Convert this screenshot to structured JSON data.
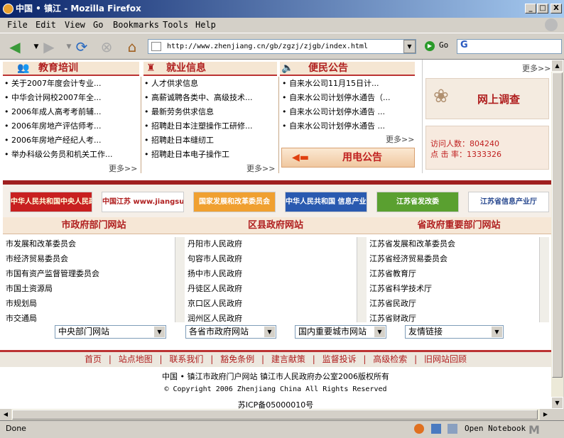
{
  "window": {
    "title": "中国 • 镇江 - Mozilla Firefox",
    "min": "_",
    "max": "□",
    "close": "X"
  },
  "menu": [
    "File",
    "Edit",
    "View",
    "Go",
    "Bookmarks",
    "Tools",
    "Help"
  ],
  "nav": {
    "url": "http://www.zhenjiang.cn/gb/zgzj/zjgb/index.html",
    "go_label": "Go",
    "search_placeholder": "G"
  },
  "sections": {
    "education": {
      "title": "教育培训",
      "items": [
        "关于2007年度会计专业...",
        "中华会计网校2007年全...",
        "2006年成人高考考前辅...",
        "2006年房地产评估师考...",
        "2006年房地产经纪人考...",
        "举办科级公务员和机关工作..."
      ],
      "more": "更多>>"
    },
    "jobs": {
      "title": "就业信息",
      "items": [
        "人才供求信息",
        "高薪诚聘各类中、高级技术...",
        "最新劳务供求信息",
        "招聘赴日本注塑操作工研修...",
        "招聘赴日本缝纫工",
        "招聘赴日本电子操作工"
      ],
      "more": "更多>>"
    },
    "notices": {
      "title": "便民公告",
      "items": [
        "自来水公司11月15日计...",
        "自来水公司计划停水通告（...",
        "自来水公司计划停水通告 ...",
        "自来水公司计划停水通告 ..."
      ],
      "more": "更多>>",
      "power": "用电公告"
    }
  },
  "sidebar": {
    "more": "更多>>",
    "survey": "网上调查",
    "visitors_label": "访问人数：",
    "visitors": "804240",
    "rate_label": "点 击 率：",
    "rate": "1333326"
  },
  "banners": [
    "中华人民共和国中央人民政府",
    "中国江苏  www.jiangsu.gov.cn",
    "国家发展和改革委员会",
    "中华人民共和国 信息产业部",
    "江苏省发改委",
    "江苏省信息产业厅"
  ],
  "links": {
    "city": {
      "title": "市政府部门网站",
      "items": [
        "市发展和改革委员会",
        "市经济贸易委员会",
        "市国有资产监督管理委员会",
        "市国土资源局",
        "市规划局",
        "市交通局"
      ]
    },
    "county": {
      "title": "区县政府网站",
      "items": [
        "丹阳市人民政府",
        "句容市人民政府",
        "扬中市人民政府",
        "丹徒区人民政府",
        "京口区人民政府",
        "润州区人民政府"
      ]
    },
    "province": {
      "title": "省政府重要部门网站",
      "items": [
        "江苏省发展和改革委员会",
        "江苏省经济贸易委员会",
        "江苏省教育厅",
        "江苏省科学技术厅",
        "江苏省民政厅",
        "江苏省财政厅"
      ]
    }
  },
  "selects": [
    "中央部门网站",
    "各省市政府网站",
    "国内重要城市网站",
    "友情链接"
  ],
  "footer": {
    "nav": [
      "首页",
      "站点地图",
      "联系我们",
      "豁免条例",
      "建言献策",
      "监督投诉",
      "高级检索",
      "旧网站回顾"
    ],
    "sep": "|",
    "line1": "中国 • 镇江市政府门户网站  镇江市人民政府办公室2006版权所有",
    "line2": "© Copyright 2006 Zhenjiang China All Rights Reserved",
    "line3": "苏ICP备05000010号"
  },
  "status": {
    "text": "Done",
    "notebook": "Open Notebook"
  },
  "colors": {
    "accent": "#b02020",
    "titlebar": "#0a246a"
  }
}
